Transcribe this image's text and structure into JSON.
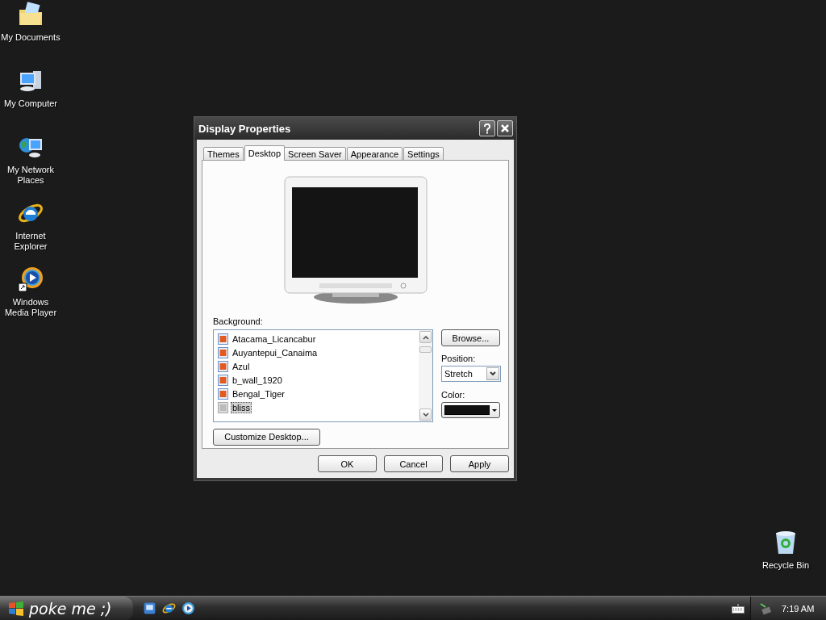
{
  "desktop_icons": [
    {
      "kind": "documents",
      "label": "My Documents"
    },
    {
      "kind": "computer",
      "label": "My Computer"
    },
    {
      "kind": "network",
      "label": "My Network Places"
    },
    {
      "kind": "ie",
      "label": "Internet Explorer"
    },
    {
      "kind": "media",
      "label": "Windows Media Player"
    }
  ],
  "recycle_bin": {
    "label": "Recycle Bin"
  },
  "dialog": {
    "title": "Display Properties",
    "tabs": [
      {
        "label": "Themes",
        "selected": false
      },
      {
        "label": "Desktop",
        "selected": true
      },
      {
        "label": "Screen Saver",
        "selected": false
      },
      {
        "label": "Appearance",
        "selected": false
      },
      {
        "label": "Settings",
        "selected": false
      }
    ],
    "background_label": "Background:",
    "backgrounds": [
      {
        "label": "Atacama_Licancabur",
        "selected": false
      },
      {
        "label": "Auyantepui_Canaima",
        "selected": false
      },
      {
        "label": "Azul",
        "selected": false
      },
      {
        "label": "b_wall_1920",
        "selected": false
      },
      {
        "label": "Bengal_Tiger",
        "selected": false
      },
      {
        "label": "bliss",
        "selected": true
      }
    ],
    "browse_button": "Browse...",
    "position_label": "Position:",
    "position_value": "Stretch",
    "color_label": "Color:",
    "customize_button": "Customize Desktop...",
    "buttons": [
      "OK",
      "Cancel",
      "Apply"
    ]
  },
  "taskbar": {
    "start_label": "poke me ;)",
    "quick_launch": [
      {
        "kind": "desktop"
      },
      {
        "kind": "ie"
      },
      {
        "kind": "media"
      }
    ],
    "clock": "7:19 AM"
  }
}
